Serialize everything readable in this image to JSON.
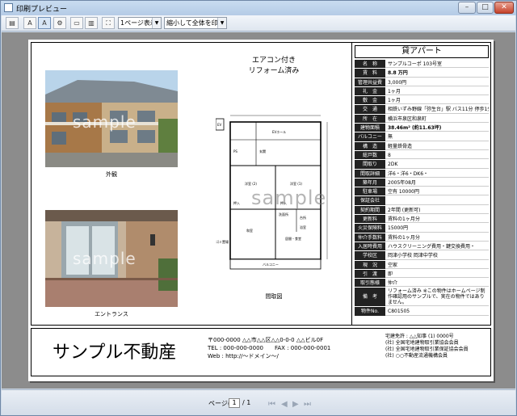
{
  "window": {
    "title": "印刷プレビュー"
  },
  "toolbar": {
    "page_mode": "1ページ表示",
    "fit_mode": "縮小して全体を印刷する"
  },
  "photos": {
    "exterior_caption": "外観",
    "entrance_caption": "エントランス",
    "watermark": "sample"
  },
  "plan": {
    "title_line1": "エアコン付き",
    "title_line2": "リフォーム済み",
    "caption": "間取図",
    "watermark": "sample",
    "labels": [
      "EV",
      "EVホール",
      "玄関",
      "PS",
      "洋室 (2)",
      "洋室 (1)",
      "押入",
      "押入",
      "和室",
      "居間・食堂",
      "台所",
      "洗面所",
      "浴室",
      "バルコニー",
      "ゴミ置場"
    ]
  },
  "details": {
    "heading": "貸アパート",
    "rows": [
      {
        "k": "名　称",
        "v": "サンプルコーポ 103号室"
      },
      {
        "k": "賃　料",
        "v": "8.8 万円",
        "bold": true
      },
      {
        "k": "管理共益費",
        "v": "3,000円"
      },
      {
        "k": "礼　金",
        "v": "1ヶ月"
      },
      {
        "k": "敷　金",
        "v": "1ヶ月"
      },
      {
        "k": "交　通",
        "v": "相鉄いずみ野線「弥生台」駅 バス11分 停歩1分"
      },
      {
        "k": "所　在",
        "v": "横浜市泉区和泉町"
      },
      {
        "k": "建物面積",
        "v": "38.46m² (約11.63坪)",
        "bold": true
      },
      {
        "k": "バルコニー",
        "v": "無"
      },
      {
        "k": "構　造",
        "v": "軽量鉄骨造"
      },
      {
        "k": "総戸数",
        "v": "8"
      },
      {
        "k": "間取り",
        "v": "2DK"
      },
      {
        "k": "間取詳細",
        "v": "洋6・洋6・DK6・"
      },
      {
        "k": "築年月",
        "v": "2005年08月"
      },
      {
        "k": "駐車場",
        "v": "空有 10000円"
      },
      {
        "k": "保証会社",
        "v": ""
      },
      {
        "k": "契約期間",
        "v": "2年間 (更新可)"
      },
      {
        "k": "更新料",
        "v": "賃料の1ヶ月分"
      },
      {
        "k": "火災保険料",
        "v": "15000円"
      },
      {
        "k": "仲介手数料",
        "v": "賃料の1ヶ月分"
      },
      {
        "k": "入居時費用",
        "v": "ハウスクリーニング費用・鍵交換費用・"
      },
      {
        "k": "学校区",
        "v": "岡津小学校 岡津中学校"
      },
      {
        "k": "現　況",
        "v": "空家"
      },
      {
        "k": "引　渡",
        "v": "即"
      },
      {
        "k": "取引態様",
        "v": "仲介"
      },
      {
        "k": "備　考",
        "v": "リフォーム済み ※この物件はホームページ制作確認用のサンプルで、実在の物件ではありません。",
        "tall": true
      },
      {
        "k": "物件No.",
        "v": "C801505"
      }
    ]
  },
  "footer": {
    "company": "サンプル不動産",
    "addr1": "〒000-0000 △△市△△区△△0-0-0 △△ビル0F",
    "addr2": "TEL : 000-000-0000　　FAX : 000-000-0001",
    "addr3": "Web : http://～ドメイン～/",
    "lic1": "宅建免許 : △△知事 (1) 0000号",
    "lic2": "(社) 全国宅地建物取引業協会会員",
    "lic3": "(社) 全国宅地建物取引業保証協会会員",
    "lic4": "(社) ○○不動産流通機構会員"
  },
  "statusbar": {
    "page_label": "ページ(A)",
    "page_value": "1",
    "page_total": "/ 1"
  },
  "colors": {
    "frame": "#6f87a6",
    "preview_bg": "#8c8c8c",
    "label_bg": "#222222"
  }
}
